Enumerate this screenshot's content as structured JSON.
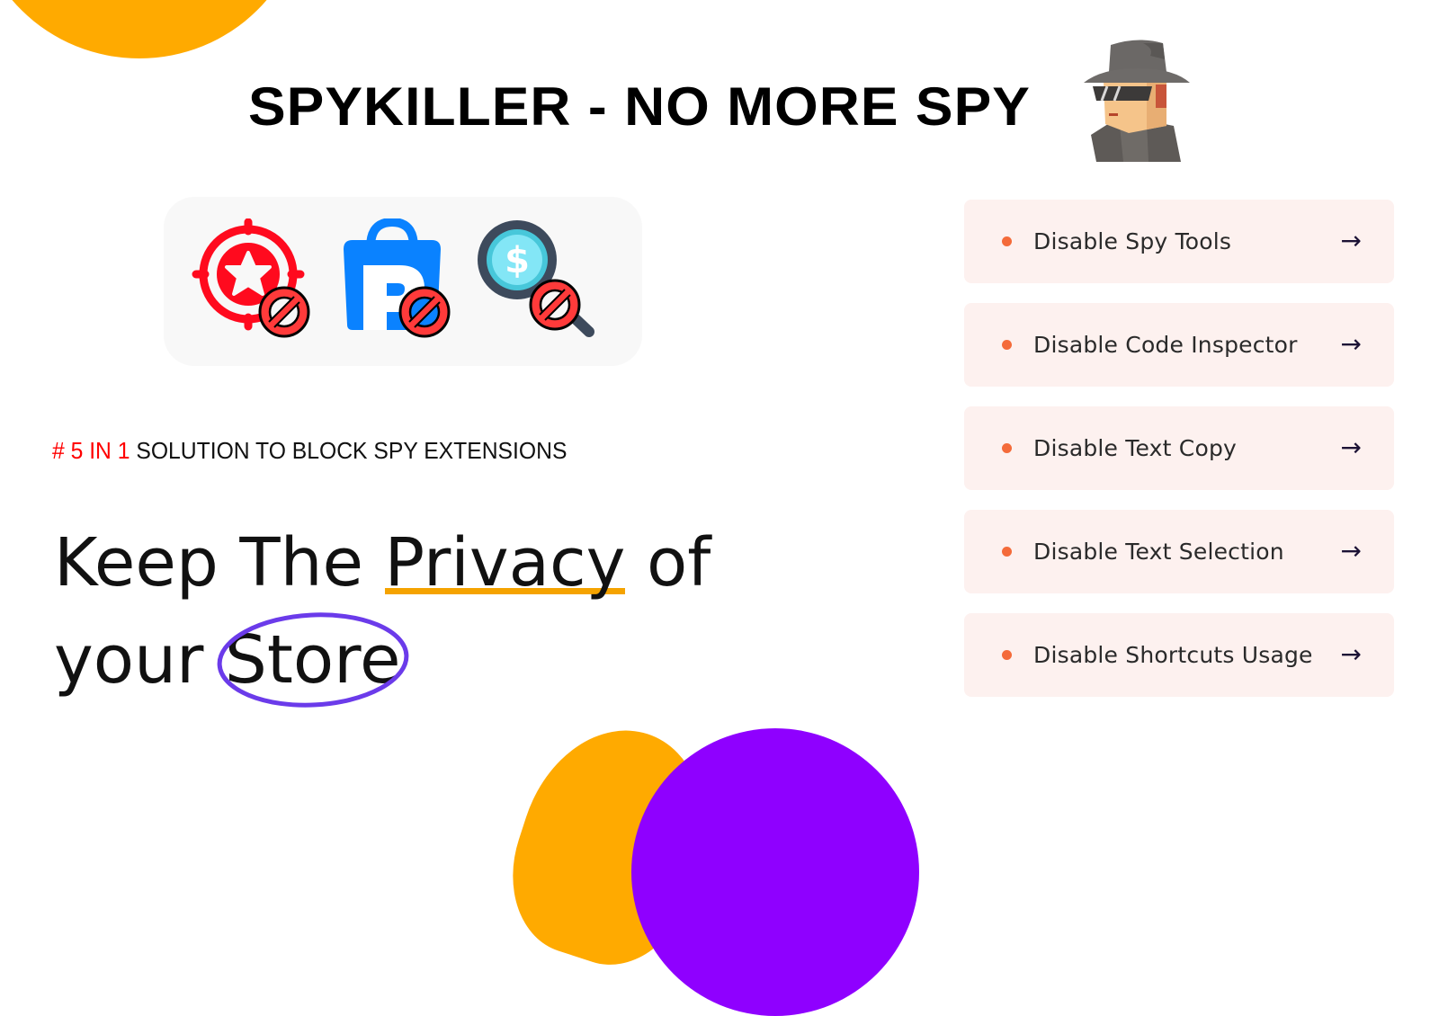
{
  "header": {
    "title": "SPYKILLER - NO MORE SPY",
    "mascot_icon": "spy-detective-icon"
  },
  "blocked_apps": [
    {
      "name": "target-star-app",
      "icon": "target-star-icon",
      "status_icon": "prohibited-icon"
    },
    {
      "name": "shopping-bag-p-app",
      "icon": "shopping-bag-icon",
      "status_icon": "prohibited-icon"
    },
    {
      "name": "price-search-app",
      "icon": "dollar-magnifier-icon",
      "status_icon": "prohibited-icon"
    }
  ],
  "tagline": {
    "accent": "# 5 IN 1",
    "text": " SOLUTION TO BLOCK SPY EXTENSIONS"
  },
  "headline": {
    "part1": "Keep The ",
    "underlined": "Privacy",
    "part2": " of",
    "part3": "your ",
    "circled": "Store"
  },
  "features": [
    {
      "label": "Disable Spy Tools",
      "arrow": "→"
    },
    {
      "label": "Disable Code Inspector",
      "arrow": "→"
    },
    {
      "label": "Disable Text Copy",
      "arrow": "→"
    },
    {
      "label": "Disable Text Selection",
      "arrow": "→"
    },
    {
      "label": "Disable Shortcuts Usage",
      "arrow": "→"
    }
  ],
  "colors": {
    "orange": "#FFAA00",
    "purple": "#8F00FF",
    "accent_red": "#FF0000",
    "bullet": "#F46B3A",
    "feature_bg": "#FDF1EF",
    "underline": "#F5A300",
    "circle": "#6B3BEA"
  }
}
